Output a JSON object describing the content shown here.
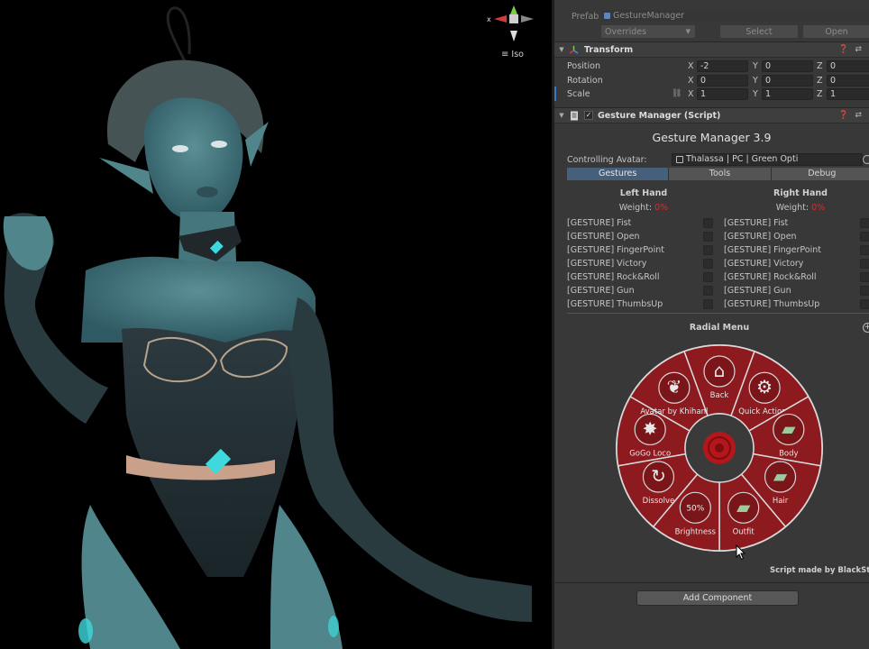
{
  "scene": {
    "view_mode": "Iso",
    "gizmo_axis_label": "x"
  },
  "inspector": {
    "prefab": {
      "label": "Prefab",
      "asset": "GestureManager",
      "overrides": "Overrides",
      "select": "Select",
      "open": "Open"
    },
    "transform": {
      "title": "Transform",
      "position": {
        "label": "Position",
        "x": "-2",
        "y": "0",
        "z": "0"
      },
      "rotation": {
        "label": "Rotation",
        "x": "0",
        "y": "0",
        "z": "0"
      },
      "scale": {
        "label": "Scale",
        "x": "1",
        "y": "1",
        "z": "1"
      }
    },
    "gesture_manager": {
      "component_title": "Gesture Manager (Script)",
      "title": "Gesture Manager 3.9",
      "controlling_label": "Controlling Avatar:",
      "controlling_value": "Thalassa | PC | Green Opti",
      "tabs": [
        "Gestures",
        "Tools",
        "Debug"
      ],
      "left_hand": {
        "title": "Left Hand",
        "weight_label": "Weight:",
        "weight_value": "0%",
        "gestures": [
          "[GESTURE] Fist",
          "[GESTURE] Open",
          "[GESTURE] FingerPoint",
          "[GESTURE] Victory",
          "[GESTURE] Rock&Roll",
          "[GESTURE] Gun",
          "[GESTURE] ThumbsUp"
        ]
      },
      "right_hand": {
        "title": "Right Hand",
        "weight_label": "Weight:",
        "weight_value": "0%",
        "gestures": [
          "[GESTURE] Fist",
          "[GESTURE] Open",
          "[GESTURE] FingerPoint",
          "[GESTURE] Victory",
          "[GESTURE] Rock&Roll",
          "[GESTURE] Gun",
          "[GESTURE] ThumbsUp"
        ]
      },
      "radial_menu": {
        "title": "Radial Menu",
        "items": [
          {
            "label": "Back",
            "icon": "back-house-icon"
          },
          {
            "label": "Quick Actions",
            "icon": "gear-icon"
          },
          {
            "label": "Body",
            "icon": "folder-icon"
          },
          {
            "label": "Hair",
            "icon": "folder-icon"
          },
          {
            "label": "Outfit",
            "icon": "folder-icon"
          },
          {
            "label": "Brightness",
            "icon": "radial-dial-icon",
            "value": "50%"
          },
          {
            "label": "Dissolve",
            "icon": "toggle-icon"
          },
          {
            "label": "GoGo Loco",
            "icon": "submenu-icon"
          },
          {
            "label": "Avatar by Khihanl",
            "icon": "butterfly-icon"
          }
        ],
        "colors": {
          "segment": "#8c1a1f",
          "border": "#d9d9d9",
          "center": "#3a3a3a",
          "center_dot": "#b5161c"
        }
      },
      "credit": "Script made by BlackStartx"
    },
    "add_component": "Add Component"
  }
}
